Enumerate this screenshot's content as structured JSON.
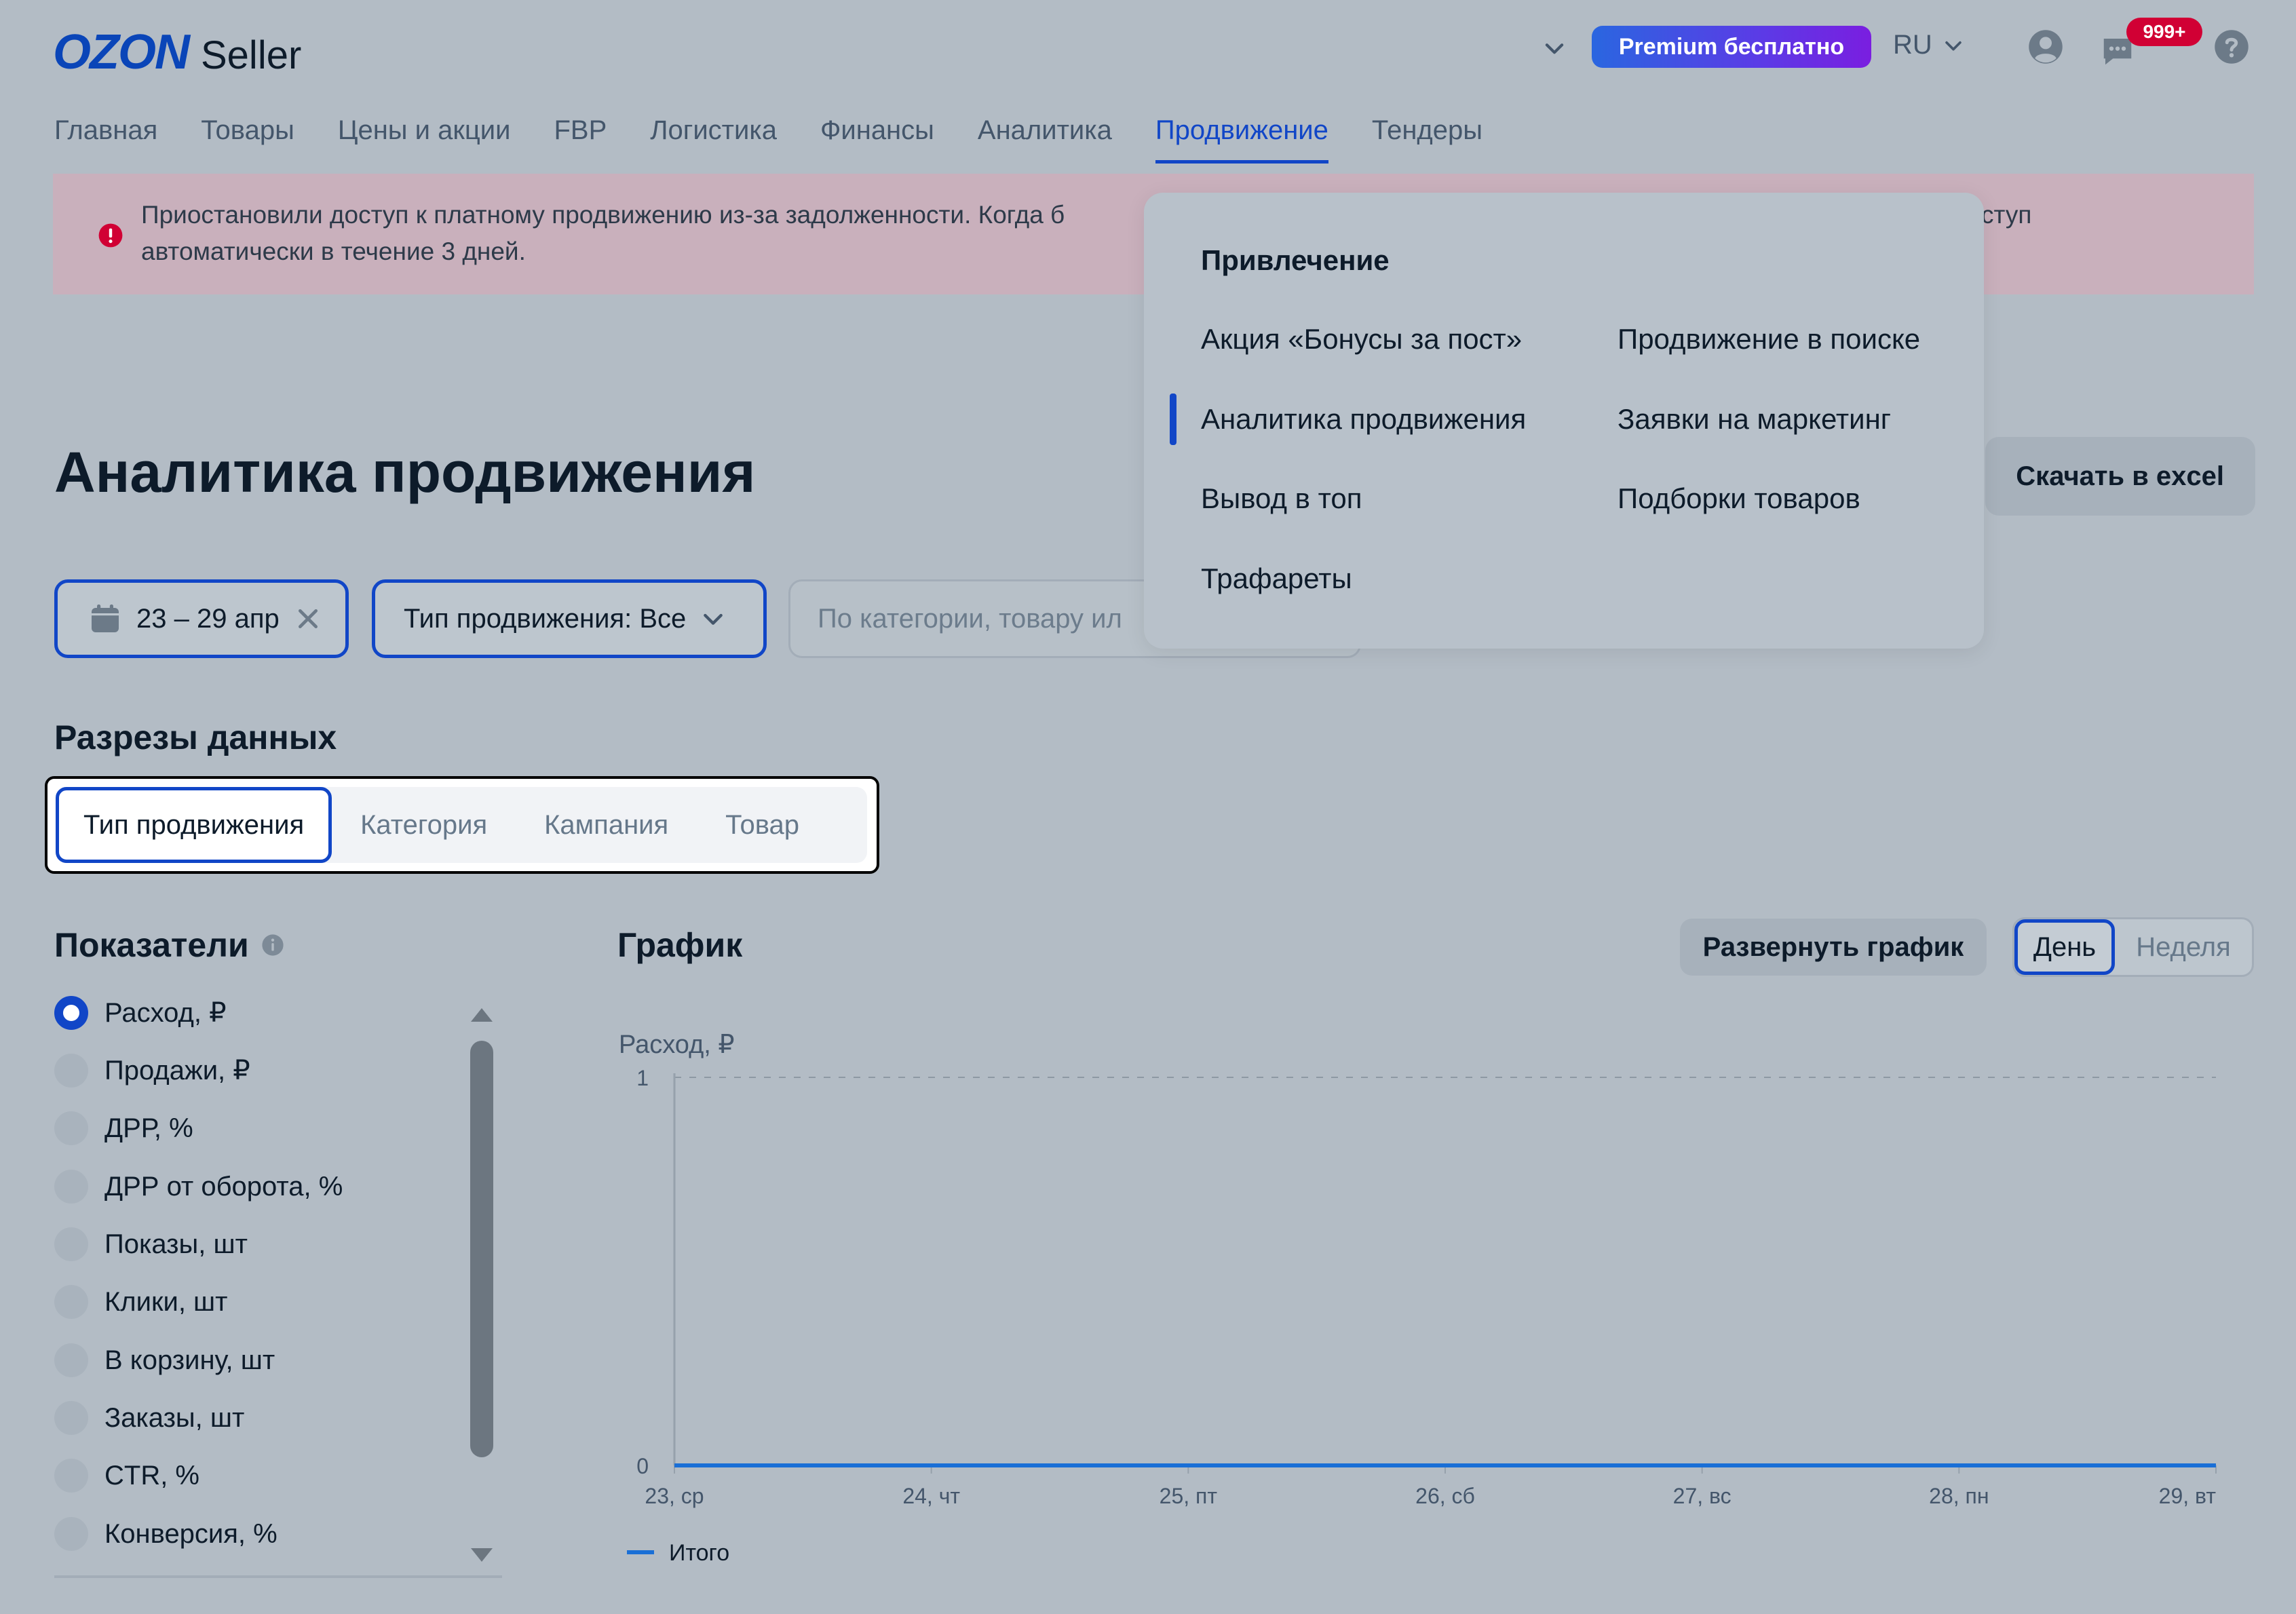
{
  "header": {
    "logo_brand": "OZON",
    "logo_product": "Seller",
    "premium_label": "Premium бесплатно",
    "language": "RU",
    "notifications_badge": "999+"
  },
  "nav": {
    "items": [
      "Главная",
      "Товары",
      "Цены и акции",
      "FBP",
      "Логистика",
      "Финансы",
      "Аналитика",
      "Продвижение",
      "Тендеры"
    ],
    "active_index": 7
  },
  "alert": {
    "text_start": "Приостановили доступ к платному продвижению из-за задолженности. Когда б",
    "text_end": "автоматически в течение 3 дней.",
    "text_tail": "ступ",
    "icon": "exclamation-circle-icon",
    "color": "#d10034"
  },
  "page": {
    "title": "Аналитика продвижения",
    "download_label": "Скачать в excel"
  },
  "filters": {
    "date_range": "23 – 29 апр",
    "type_label": "Тип продвижения: Все",
    "search_placeholder": "По категории, товару ил"
  },
  "slices": {
    "title": "Разрезы данных",
    "tabs": [
      "Тип продвижения",
      "Категория",
      "Кампания",
      "Товар"
    ],
    "active_index": 0
  },
  "metrics": {
    "title": "Показатели",
    "items": [
      {
        "label": "Расход, ₽",
        "selected": true
      },
      {
        "label": "Продажи, ₽",
        "selected": false
      },
      {
        "label": "ДРР, %",
        "selected": false
      },
      {
        "label": "ДРР от оборота, %",
        "selected": false
      },
      {
        "label": "Показы, шт",
        "selected": false
      },
      {
        "label": "Клики, шт",
        "selected": false
      },
      {
        "label": "В корзину, шт",
        "selected": false
      },
      {
        "label": "Заказы, шт",
        "selected": false
      },
      {
        "label": "CTR, %",
        "selected": false
      },
      {
        "label": "Конверсия, %",
        "selected": false
      }
    ]
  },
  "chart_panel": {
    "title": "График",
    "expand_label": "Развернуть график",
    "period_options": [
      "День",
      "Неделя"
    ],
    "period_active_index": 0
  },
  "chart_data": {
    "type": "line",
    "ylabel": "Расход, ₽",
    "x": [
      "23, ср",
      "24, чт",
      "25, пт",
      "26, сб",
      "27, вс",
      "28, пн",
      "29, вт"
    ],
    "y_ticks": [
      "0",
      "1"
    ],
    "ylim": [
      0,
      1
    ],
    "series": [
      {
        "name": "Итого",
        "values": [
          0,
          0,
          0,
          0,
          0,
          0,
          0
        ],
        "color": "#1a6fd6"
      }
    ],
    "legend": "bottom-left",
    "grid": "top dashed line only"
  },
  "promo_menu": {
    "section_title": "Привлечение",
    "left_items": [
      "Акция «Бонусы за пост»",
      "Аналитика продвижения",
      "Вывод в топ",
      "Трафареты"
    ],
    "right_items": [
      "Продвижение в поиске",
      "Заявки на маркетинг",
      "Подборки товаров"
    ],
    "active_item": "Аналитика продвижения"
  }
}
